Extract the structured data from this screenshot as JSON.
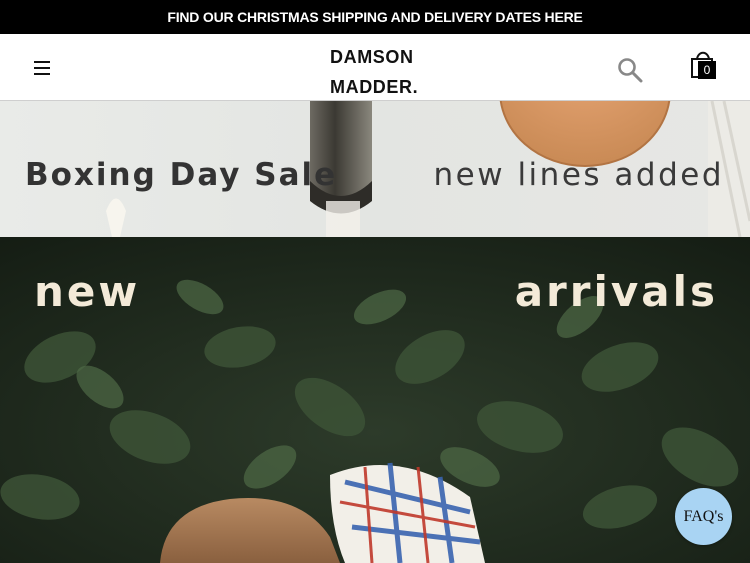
{
  "announcement": {
    "text": "FIND OUR CHRISTMAS SHIPPING AND DELIVERY DATES HERE"
  },
  "header": {
    "logo_line1": "DAMSON",
    "logo_line2": "MADDER.",
    "cart_count": "0",
    "icons": {
      "menu": "hamburger-icon",
      "search": "search-icon",
      "cart": "shopping-bag-icon"
    }
  },
  "hero_banner": {
    "left_text": "Boxing Day Sale",
    "right_text": "new lines added"
  },
  "arrivals_banner": {
    "left_text": "new",
    "right_text": "arrivals"
  },
  "faq_button": {
    "label": "FAQ's"
  },
  "colors": {
    "announcement_bg": "#000000",
    "faq_bg": "#a9d4f3",
    "banner_text_dark": "#333333",
    "banner_text_light": "#f3ead8"
  }
}
